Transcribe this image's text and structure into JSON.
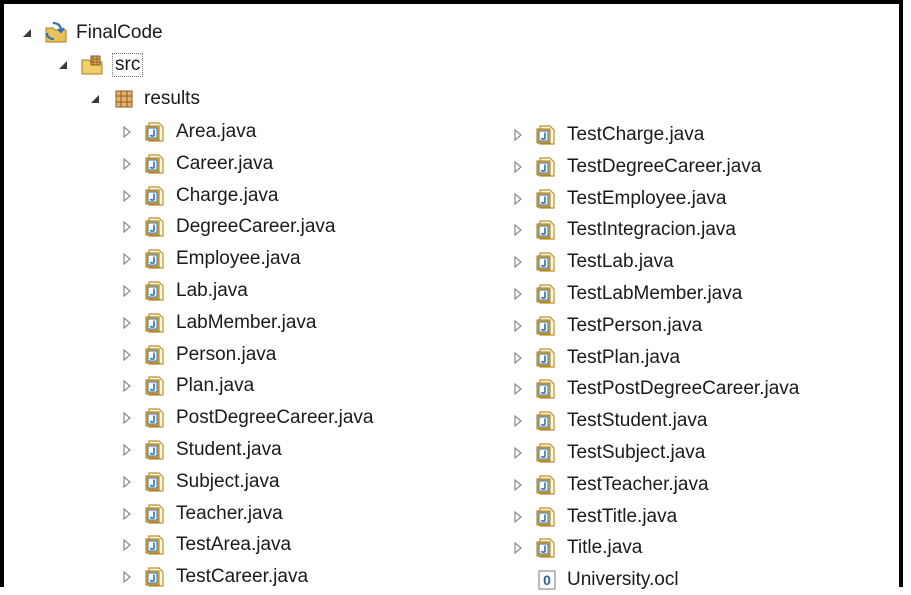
{
  "tree": {
    "project": {
      "label": "FinalCode",
      "icon": "java-project-icon"
    },
    "source_folder": {
      "label": "src",
      "icon": "source-folder-icon"
    },
    "package": {
      "label": "results",
      "icon": "package-icon"
    },
    "left_files": [
      "Area.java",
      "Career.java",
      "Charge.java",
      "DegreeCareer.java",
      "Employee.java",
      "Lab.java",
      "LabMember.java",
      "Person.java",
      "Plan.java",
      "PostDegreeCareer.java",
      "Student.java",
      "Subject.java",
      "Teacher.java",
      "TestArea.java",
      "TestCareer.java"
    ],
    "right_files": [
      {
        "label": "TestCharge.java",
        "icon": "java-file-icon",
        "expandable": true
      },
      {
        "label": "TestDegreeCareer.java",
        "icon": "java-file-icon",
        "expandable": true
      },
      {
        "label": "TestEmployee.java",
        "icon": "java-file-icon",
        "expandable": true
      },
      {
        "label": "TestIntegracion.java",
        "icon": "java-file-icon",
        "expandable": true
      },
      {
        "label": "TestLab.java",
        "icon": "java-file-icon",
        "expandable": true
      },
      {
        "label": "TestLabMember.java",
        "icon": "java-file-icon",
        "expandable": true
      },
      {
        "label": "TestPerson.java",
        "icon": "java-file-icon",
        "expandable": true
      },
      {
        "label": "TestPlan.java",
        "icon": "java-file-icon",
        "expandable": true
      },
      {
        "label": "TestPostDegreeCareer.java",
        "icon": "java-file-icon",
        "expandable": true
      },
      {
        "label": "TestStudent.java",
        "icon": "java-file-icon",
        "expandable": true
      },
      {
        "label": "TestSubject.java",
        "icon": "java-file-icon",
        "expandable": true
      },
      {
        "label": "TestTeacher.java",
        "icon": "java-file-icon",
        "expandable": true
      },
      {
        "label": "TestTitle.java",
        "icon": "java-file-icon",
        "expandable": true
      },
      {
        "label": "Title.java",
        "icon": "java-file-icon",
        "expandable": true
      },
      {
        "label": "University.ocl",
        "icon": "ocl-file-icon",
        "expandable": false
      }
    ]
  }
}
